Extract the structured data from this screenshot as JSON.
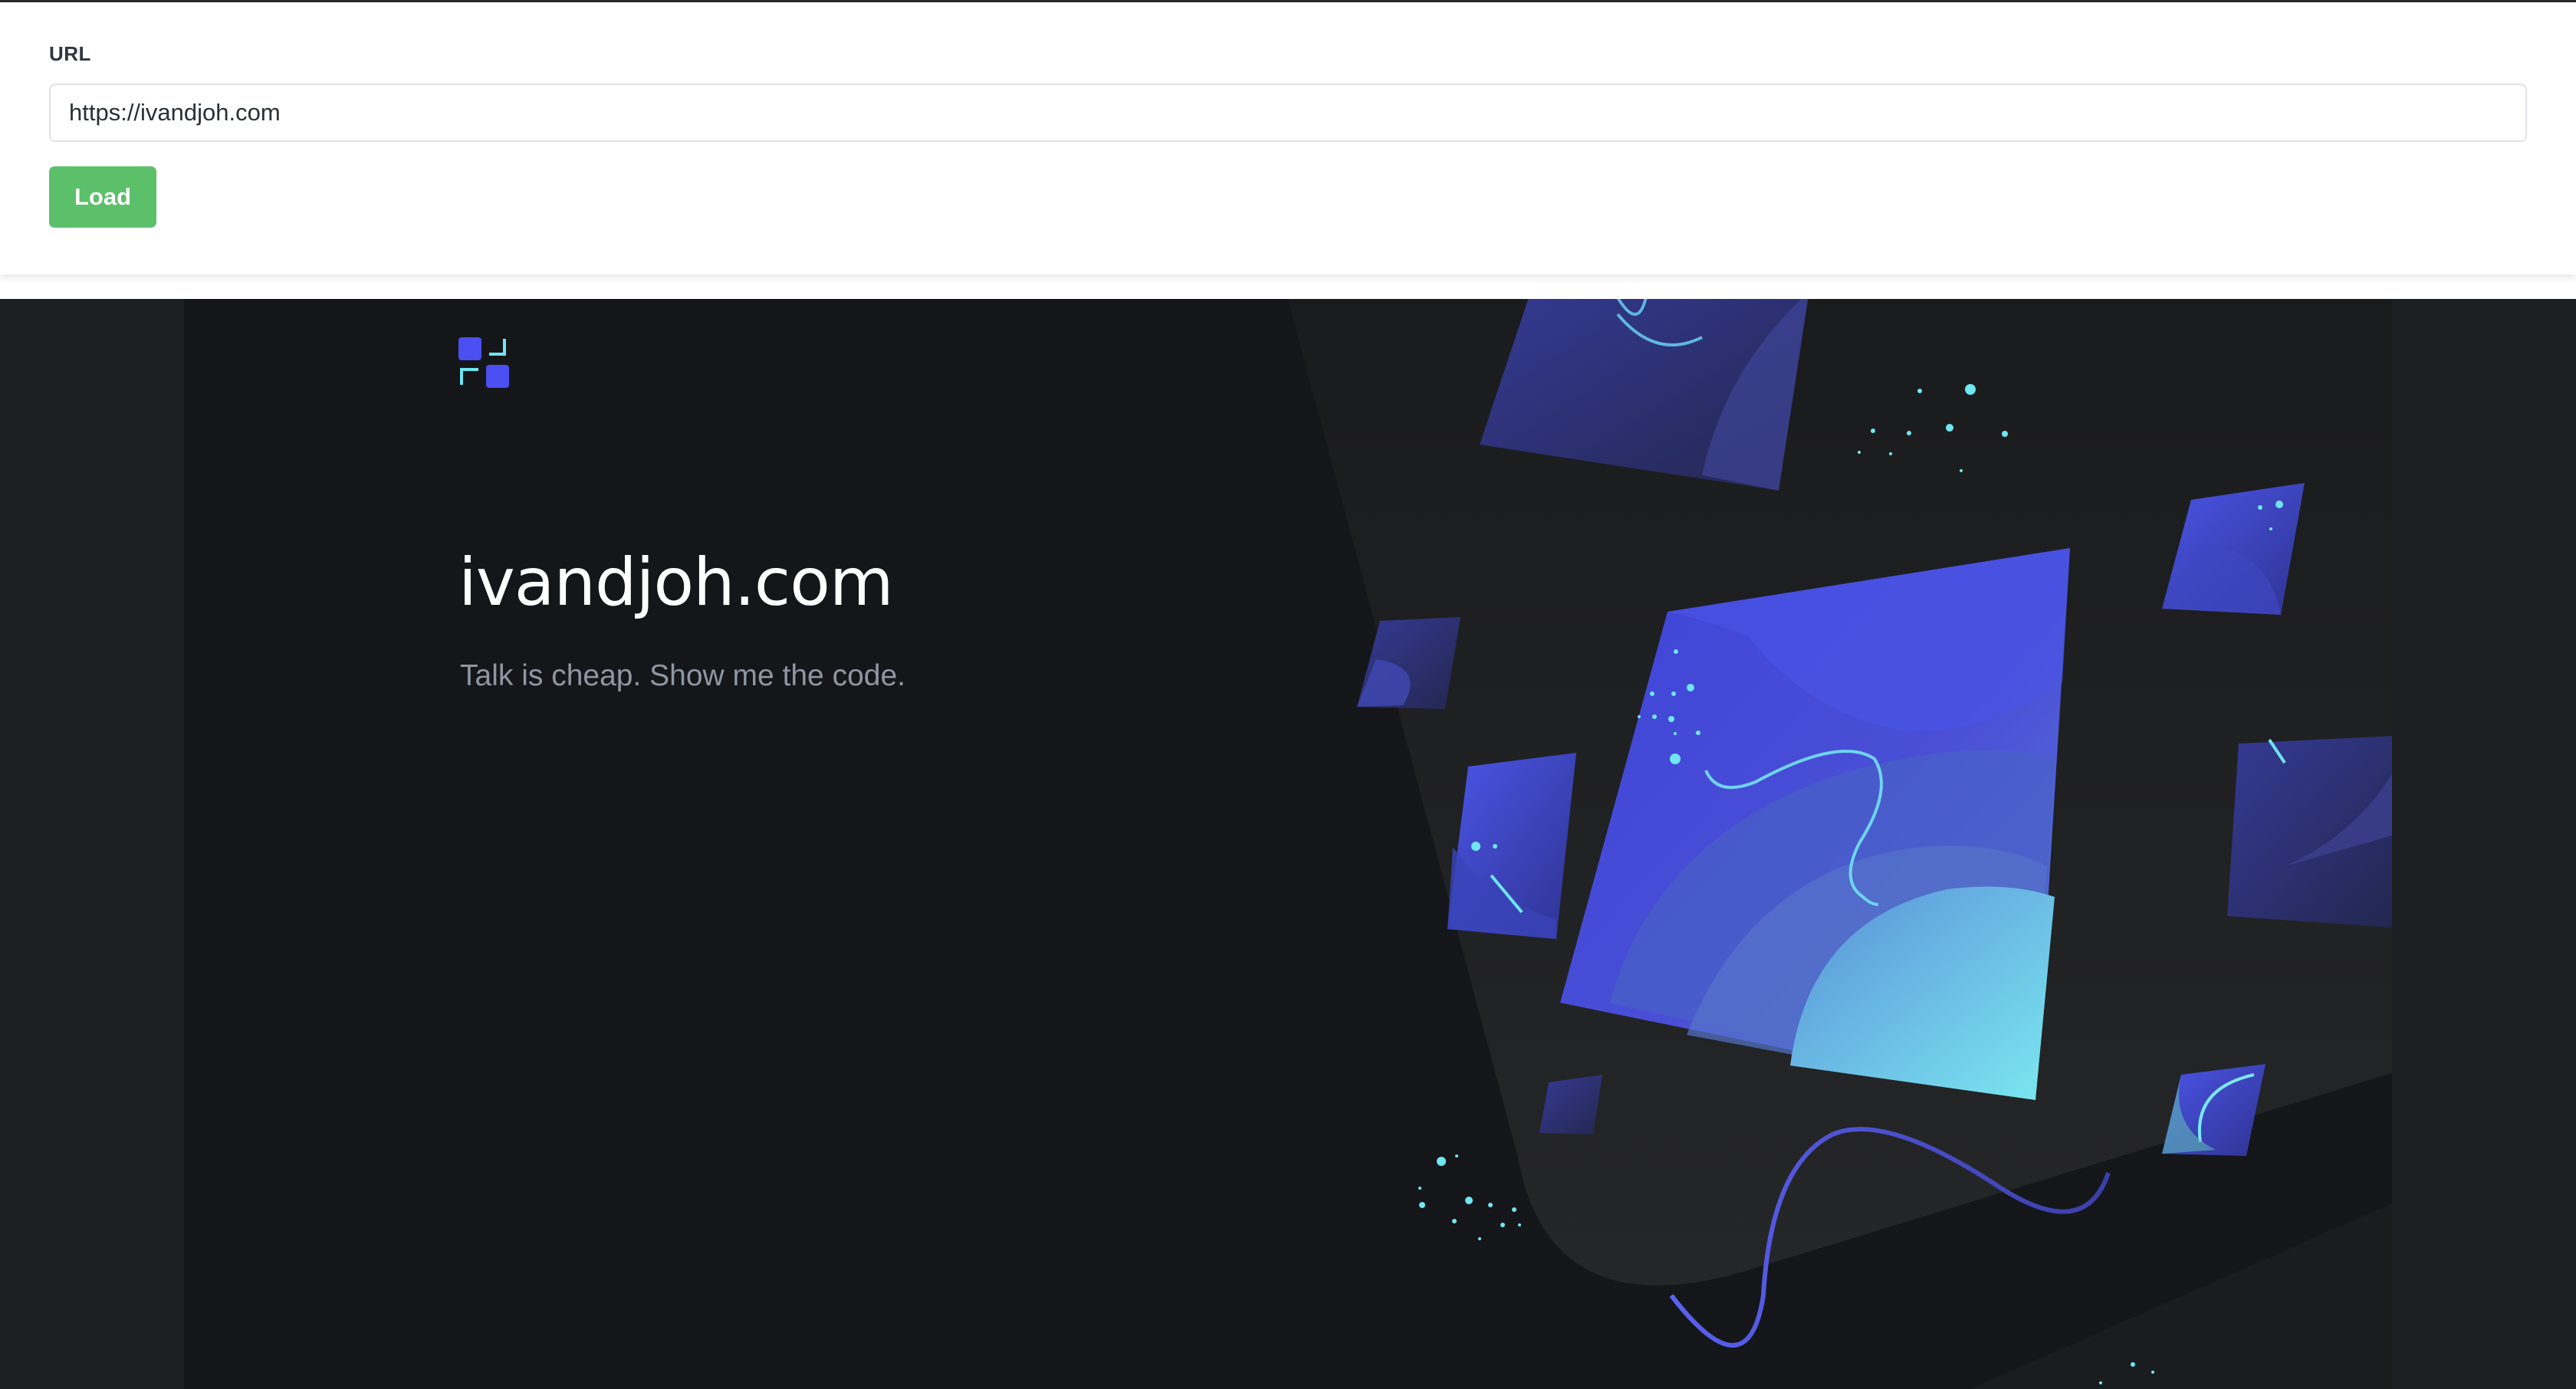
{
  "toolbar": {
    "url_label": "URL",
    "url_value": "https://ivandjoh.com",
    "load_label": "Load"
  },
  "site": {
    "title": "ivandjoh.com",
    "tagline": "Talk is cheap. Show me the code.",
    "logo_icon": "grid-logo-icon"
  },
  "colors": {
    "load_button": "#5cc06a",
    "page_background": "#151619",
    "accent_blue": "#4b4ef0",
    "accent_cyan": "#6fe6f2"
  }
}
